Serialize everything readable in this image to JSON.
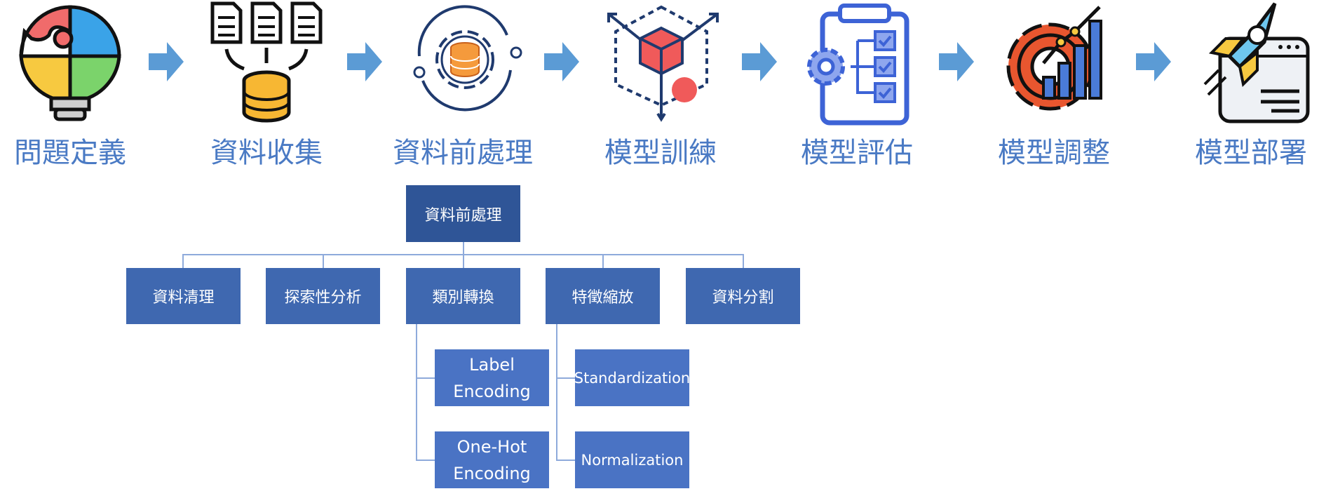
{
  "pipeline": {
    "steps": [
      {
        "label": "問題定義",
        "icon": "puzzle-lightbulb-icon"
      },
      {
        "label": "資料收集",
        "icon": "documents-database-icon"
      },
      {
        "label": "資料前處理",
        "icon": "gear-database-cycle-icon"
      },
      {
        "label": "模型訓練",
        "icon": "3d-cube-icon"
      },
      {
        "label": "模型評估",
        "icon": "clipboard-checklist-icon"
      },
      {
        "label": "模型調整",
        "icon": "gear-bar-chart-icon"
      },
      {
        "label": "模型部署",
        "icon": "rocket-browser-icon"
      }
    ],
    "arrow_color": "#5b9bd5",
    "label_color": "#4a7ac4"
  },
  "tree": {
    "root": "資料前處理",
    "children": [
      "資料清理",
      "探索性分析",
      "類別轉換",
      "特徵縮放",
      "資料分割"
    ],
    "category_subitems": [
      "Label\nEncoding",
      "One-Hot\nEncoding"
    ],
    "scaling_subitems": [
      "Standardization",
      "Normalization"
    ],
    "box_color": "#3f68b0",
    "root_color": "#2f5597",
    "connector_color": "#8eaadb"
  }
}
